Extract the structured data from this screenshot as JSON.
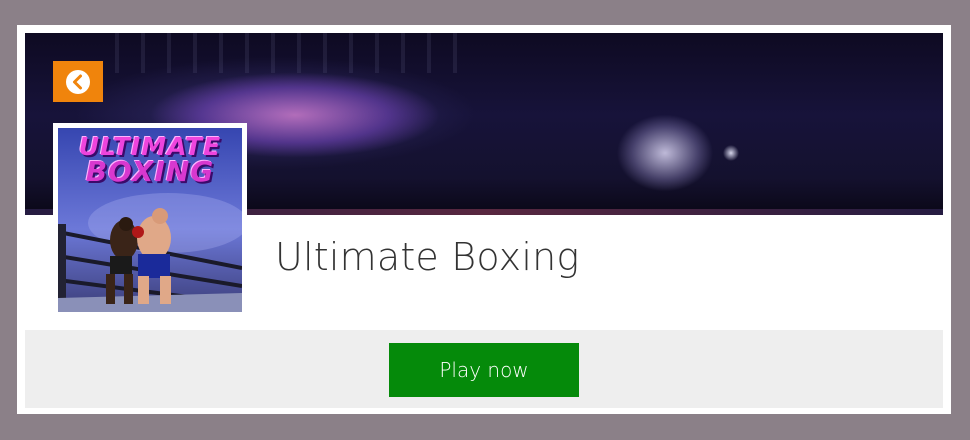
{
  "game": {
    "title": "Ultimate Boxing",
    "thumbnail_logo_line1": "ULTIMATE",
    "thumbnail_logo_line2": "BOXING"
  },
  "header": {
    "back_icon": "chevron-left-circle-icon"
  },
  "actions": {
    "play_label": "Play now"
  },
  "colors": {
    "page_background": "#8b8088",
    "back_button": "#f0840c",
    "play_button": "#058a0a",
    "action_bar": "#eeeeee"
  }
}
